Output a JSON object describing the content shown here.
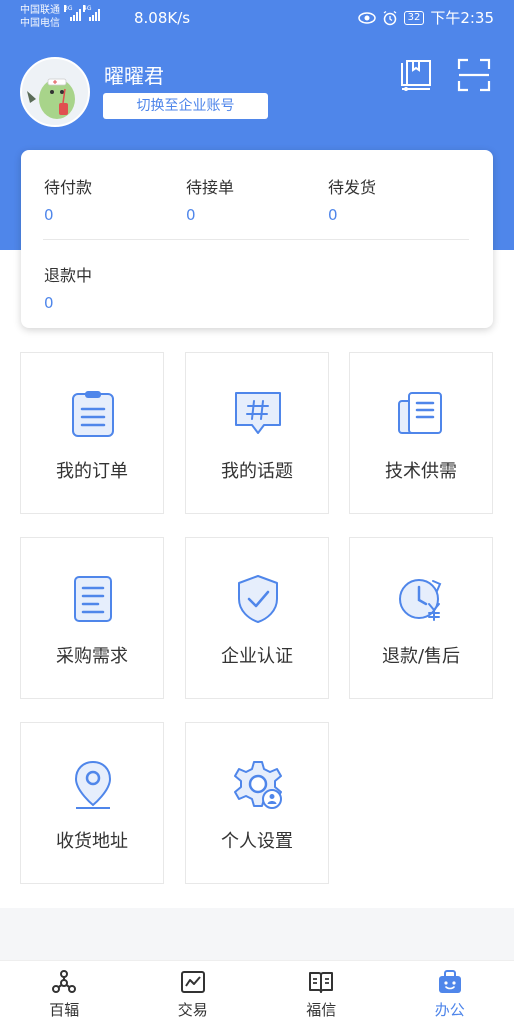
{
  "status_bar": {
    "carrier_1": "中国联通",
    "carrier_2": "中国电信",
    "signal_1_tag": "3G",
    "signal_2_tag": "4G",
    "net_speed": "8.08K/s",
    "battery": "32",
    "time": "下午2:35"
  },
  "profile": {
    "username": "曜曜君",
    "switch_label": "切换至企业账号"
  },
  "orders": {
    "items": [
      {
        "label": "待付款",
        "count": "0"
      },
      {
        "label": "待接单",
        "count": "0"
      },
      {
        "label": "待发货",
        "count": "0"
      },
      {
        "label": "退款中",
        "count": "0"
      }
    ]
  },
  "menu": {
    "items": [
      {
        "label": "我的订单",
        "icon": "clipboard-icon"
      },
      {
        "label": "我的话题",
        "icon": "topic-icon"
      },
      {
        "label": "技术供需",
        "icon": "documents-icon"
      },
      {
        "label": "采购需求",
        "icon": "purchase-list-icon"
      },
      {
        "label": "企业认证",
        "icon": "shield-check-icon"
      },
      {
        "label": "退款/售后",
        "icon": "refund-clock-icon"
      },
      {
        "label": "收货地址",
        "icon": "location-pin-icon"
      },
      {
        "label": "个人设置",
        "icon": "user-settings-icon"
      }
    ]
  },
  "tabs": {
    "items": [
      {
        "label": "百辐",
        "icon": "network-icon"
      },
      {
        "label": "交易",
        "icon": "trade-icon"
      },
      {
        "label": "福信",
        "icon": "news-icon"
      },
      {
        "label": "办公",
        "icon": "office-bag-icon"
      }
    ],
    "active_index": 3
  },
  "colors": {
    "accent": "#4f86ea",
    "header_background": "#4f86ea",
    "text": "#333333"
  }
}
